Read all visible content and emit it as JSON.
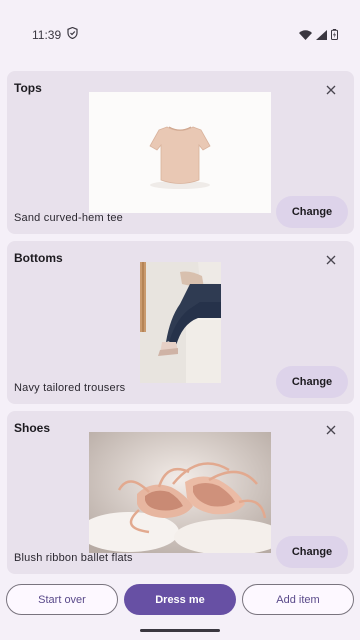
{
  "status_bar": {
    "time": "11:39",
    "icons": [
      "shield-icon",
      "wifi-icon",
      "cell-signal-icon",
      "battery-icon"
    ]
  },
  "cards": [
    {
      "title": "Tops",
      "item_name": "Sand curved-hem tee",
      "change_label": "Change",
      "image": "tshirt-photo"
    },
    {
      "title": "Bottoms",
      "item_name": "Navy tailored trousers",
      "change_label": "Change",
      "image": "trousers-photo"
    },
    {
      "title": "Shoes",
      "item_name": "Blush ribbon ballet flats",
      "change_label": "Change",
      "image": "ballet-flats-photo"
    }
  ],
  "actions": {
    "start_over": "Start over",
    "dress_me": "Dress me",
    "add_item": "Add item"
  },
  "colors": {
    "background": "#f5f0f8",
    "card": "#e8e1ec",
    "primary": "#6750a4",
    "tonal": "#ddd3ea"
  }
}
